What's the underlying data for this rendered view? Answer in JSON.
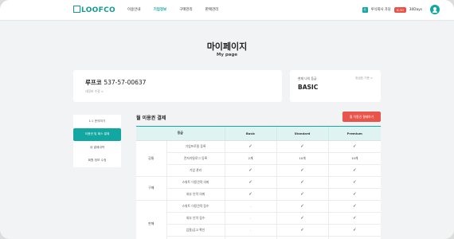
{
  "header": {
    "logo_text": "LOOFCO",
    "nav": [
      {
        "label": "이용안내",
        "active": false
      },
      {
        "label": "기업정보",
        "active": true
      },
      {
        "label": "구매관리",
        "active": false
      },
      {
        "label": "판매관리",
        "active": false
      }
    ],
    "company_badge": "주",
    "company_name": "루식회사 가당",
    "d_badge": "D-30",
    "days": "30Days"
  },
  "page": {
    "title": "마이페이지",
    "subtitle": "My page"
  },
  "account": {
    "company": "루프코",
    "biz_number": "537-57-00637",
    "edit_link": "내정보 수정 >"
  },
  "plan": {
    "label": "현재 나의 등급",
    "link": "등급표 기준 >",
    "value": "BASIC"
  },
  "sidebar": [
    {
      "label": "1:1 문의하기",
      "active": false
    },
    {
      "label": "이용권 및 패스 결제",
      "active": true
    },
    {
      "label": "내 결제내역",
      "active": false
    },
    {
      "label": "회원 정보 수정",
      "active": false
    }
  ],
  "section": {
    "title": "월 이용권 결제",
    "pay_button": "월 이용권 결제하기"
  },
  "table": {
    "headers": [
      "등급",
      "Basic",
      "Standard",
      "Premium"
    ],
    "groups": [
      {
        "name": "공통",
        "rows": [
          {
            "feature": "기업프로필 등록",
            "cells": [
              "✓",
              "✓",
              "✓"
            ]
          },
          {
            "feature": "전자카탈로그 등록",
            "cells": [
              "2개",
              "10개",
              "10개"
            ]
          },
          {
            "feature": "기업 관리",
            "cells": [
              "✓",
              "✓",
              "✓"
            ]
          }
        ]
      },
      {
        "name": "구매",
        "rows": [
          {
            "feature": "스위트 이용견적 의뢰",
            "cells": [
              "✓",
              "✓",
              "✓"
            ]
          },
          {
            "feature": "외부 인력 의뢰",
            "cells": [
              "✓",
              "✓",
              "✓"
            ]
          }
        ]
      },
      {
        "name": "판매",
        "rows": [
          {
            "feature": "스위트 이용견적 접수",
            "cells": [
              "-",
              "✓",
              "✓"
            ]
          },
          {
            "feature": "외부 인력 접수",
            "cells": [
              "-",
              "✓",
              "✓"
            ]
          },
          {
            "feature": "입찰/공고 확인",
            "cells": [
              "-",
              "✓",
              "✓"
            ]
          },
          {
            "feature": "",
            "cells": [
              "-",
              "✓",
              "✓"
            ]
          }
        ]
      }
    ]
  }
}
